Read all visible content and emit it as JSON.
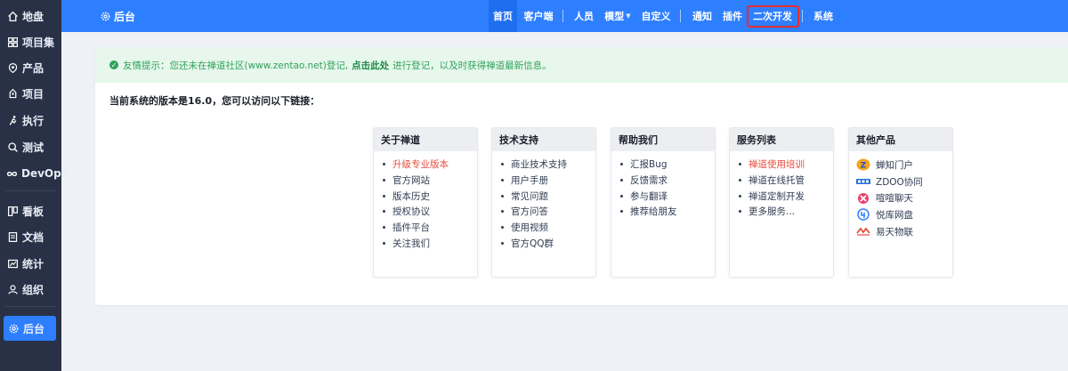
{
  "sidebar": {
    "items": [
      {
        "label": "地盘",
        "icon": "home-icon"
      },
      {
        "label": "项目集",
        "icon": "grid-icon"
      },
      {
        "label": "产品",
        "icon": "product-icon"
      },
      {
        "label": "项目",
        "icon": "project-icon"
      },
      {
        "label": "执行",
        "icon": "run-icon"
      },
      {
        "label": "测试",
        "icon": "search-icon"
      },
      {
        "label": "DevOps",
        "icon": "infinity-icon"
      },
      {
        "label": "看板",
        "icon": "kanban-icon"
      },
      {
        "label": "文档",
        "icon": "doc-icon"
      },
      {
        "label": "统计",
        "icon": "chart-icon"
      },
      {
        "label": "组织",
        "icon": "user-icon"
      },
      {
        "label": "后台",
        "icon": "gear-icon"
      }
    ]
  },
  "topbar": {
    "brand": "后台",
    "nav": {
      "home": "首页",
      "client": "客户端",
      "people": "人员",
      "model": "模型",
      "custom": "自定义",
      "notify": "通知",
      "plugin": "插件",
      "dev": "二次开发",
      "system": "系统"
    }
  },
  "alert": {
    "prefix": "友情提示：您还未在禅道社区(www.zentao.net)登记,",
    "link": "点击此处",
    "suffix": "进行登记，以及时获得禅道最新信息。"
  },
  "version_line": "当前系统的版本是16.0，您可以访问以下链接：",
  "boxes": {
    "about": {
      "title": "关于禅道",
      "items": [
        "升级专业版本",
        "官方网站",
        "版本历史",
        "授权协议",
        "插件平台",
        "关注我们"
      ]
    },
    "support": {
      "title": "技术支持",
      "items": [
        "商业技术支持",
        "用户手册",
        "常见问题",
        "官方问答",
        "使用视频",
        "官方QQ群"
      ]
    },
    "help": {
      "title": "帮助我们",
      "items": [
        "汇报Bug",
        "反馈需求",
        "参与翻译",
        "推荐给朋友"
      ]
    },
    "service": {
      "title": "服务列表",
      "items": [
        "禅道使用培训",
        "禅道在线托管",
        "禅道定制开发",
        "更多服务..."
      ]
    },
    "products": {
      "title": "其他产品",
      "items": [
        "蝉知门户",
        "ZDOO协同",
        "喧喧聊天",
        "悦库网盘",
        "易天物联"
      ]
    }
  },
  "colors": {
    "sidebar_bg": "#283146",
    "topbar_bg": "#2e7fff",
    "highlight_red": "#e84c3d",
    "alert_green": "#2fa35a"
  }
}
